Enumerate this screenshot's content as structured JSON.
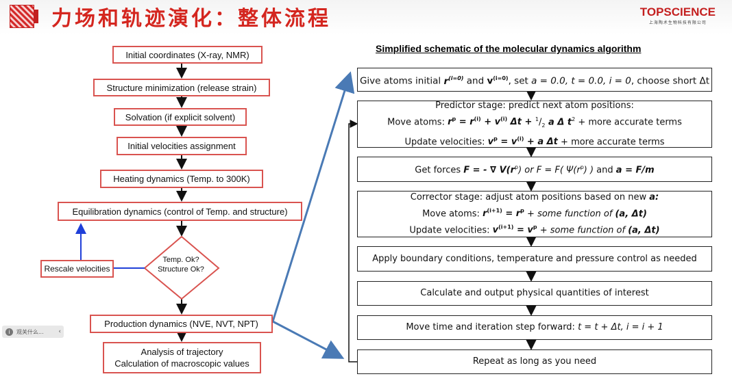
{
  "slide": {
    "title": "力场和轨迹演化：整体流程",
    "brand_name": "TOPSCIENCE",
    "brand_sub": "上海陶术生物科技有限公司"
  },
  "left_flow": {
    "steps": [
      "Initial coordinates (X-ray, NMR)",
      "Structure minimization (release strain)",
      "Solvation (if explicit solvent)",
      "Initial velocities assignment",
      "Heating dynamics (Temp. to 300K)",
      "Equilibration dynamics (control of Temp. and structure)"
    ],
    "decision_line1": "Temp. Ok?",
    "decision_line2": "Structure Ok?",
    "rescale": "Rescale velocities",
    "production": "Production dynamics (NVE, NVT, NPT)",
    "analysis_line1": "Analysis of trajectory",
    "analysis_line2": "Calculation of macroscopic values"
  },
  "schematic": {
    "title": "Simplified schematic of the molecular dynamics algorithm",
    "s1_a": "Give atoms initial ",
    "s1_r": "r",
    "s1_r_sup": "(i=0)",
    "s1_b": " and ",
    "s1_v": "v",
    "s1_v_sup": "(i=0)",
    "s1_c": ", set ",
    "s1_d": "a = 0.0, t = 0.0, i = 0",
    "s1_e": ", choose short Δt",
    "s2_l1": "Predictor stage: predict next atom positions:",
    "s2_l2a": "Move atoms: ",
    "s2_l2b": "r",
    "s2_l2b_sup": "p",
    "s2_l2c": " = r",
    "s2_l2c_sup": "(i)",
    "s2_l2d": " + v",
    "s2_l2d_sup": "(i)",
    "s2_l2e": " Δt + ",
    "s2_l2f": "1",
    "s2_l2g": "/",
    "s2_l2h": "2",
    "s2_l2i": " a Δ t",
    "s2_l2i_sup": "2",
    "s2_l2j": " + more accurate terms",
    "s2_l3a": "Update velocities: ",
    "s2_l3b": "v",
    "s2_l3b_sup": "p",
    "s2_l3c": " = v",
    "s2_l3c_sup": "(i)",
    "s2_l3d": " + a Δt",
    "s2_l3e": " + more accurate terms",
    "s3_a": "Get forces ",
    "s3_b": "F = - ∇ V(r",
    "s3_b_sup": "p",
    "s3_c": ") or F = F( Ψ(r",
    "s3_c_sup": "p",
    "s3_d": ") )",
    "s3_e": " and ",
    "s3_f": "a = F/m",
    "s4_l1a": "Corrector stage: adjust atom positions based on new ",
    "s4_l1b": "a:",
    "s4_l2a": "Move atoms: ",
    "s4_l2b": "r",
    "s4_l2b_sup": "(i+1)",
    "s4_l2c": " = r",
    "s4_l2c_sup": "p",
    "s4_l2d": " + some function of ",
    "s4_l2e": "(a, Δt)",
    "s4_l3a": "Update velocities: ",
    "s4_l3b": "v",
    "s4_l3b_sup": "(i+1)",
    "s4_l3c": " = v",
    "s4_l3c_sup": "p",
    "s4_l3d": " + some function of ",
    "s4_l3e": "(a, Δt)",
    "s5": "Apply boundary conditions, temperature and pressure control as needed",
    "s6": "Calculate and output physical quantities of interest",
    "s7a": "Move time and iteration step forward: ",
    "s7b": "t = t + Δt, i = i + 1",
    "s8": "Repeat as long as you need"
  },
  "toast": {
    "text": "观关什么...",
    "icon": "info-icon",
    "chevron": "‹"
  },
  "colors": {
    "title_red": "#d4261f",
    "box_border": "#d9534f",
    "connector_blue": "#4a7ab5",
    "loop_blue": "#1f3fd8"
  }
}
